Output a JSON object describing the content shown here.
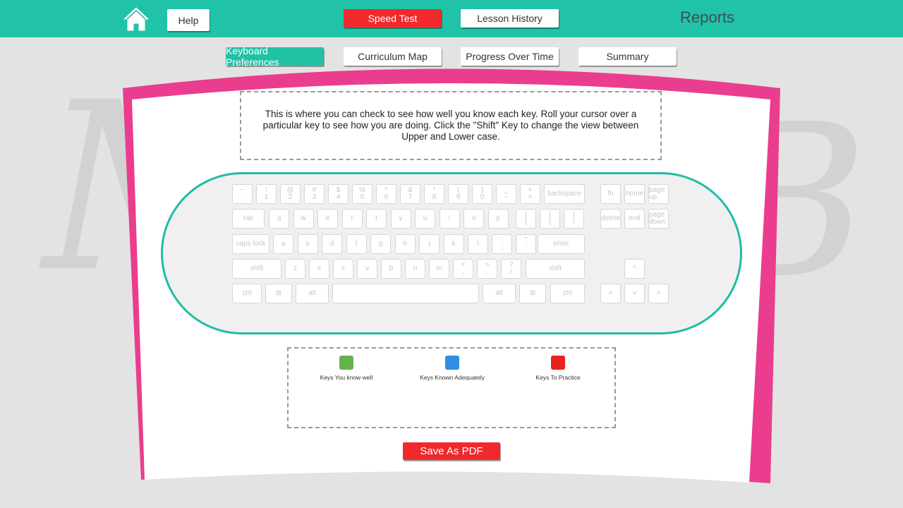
{
  "topbar": {
    "help_label": "Help",
    "speed_test_label": "Speed Test",
    "lesson_history_label": "Lesson History",
    "title": "Reports"
  },
  "subnav": {
    "tabs": [
      {
        "label": "Keyboard Preferences",
        "active": true
      },
      {
        "label": "Curriculum Map",
        "active": false
      },
      {
        "label": "Progress Over Time",
        "active": false
      },
      {
        "label": "Summary",
        "active": false
      }
    ]
  },
  "intro_text": "This is where you can check to see how well you know each key. Roll your cursor over a particular key to see how you are doing. Click the \"Shift\" Key to change the view between Upper and Lower case.",
  "keyboard": {
    "row1": [
      [
        "~",
        "`"
      ],
      [
        "!",
        "1"
      ],
      [
        "@",
        "2"
      ],
      [
        "#",
        "3"
      ],
      [
        "$",
        "4"
      ],
      [
        "%",
        "5"
      ],
      [
        "^",
        "6"
      ],
      [
        "&",
        "7"
      ],
      [
        "*",
        "8"
      ],
      [
        "(",
        "9"
      ],
      [
        ")",
        "0"
      ],
      [
        "_",
        "–"
      ],
      [
        "+",
        "="
      ]
    ],
    "backspace": "backspace",
    "tab": "tab",
    "row2": [
      "q",
      "w",
      "e",
      "r",
      "t",
      "y",
      "u",
      "i",
      "o",
      "p"
    ],
    "row2_sym": [
      [
        "{",
        "["
      ],
      [
        "}",
        "]"
      ],
      [
        "|",
        "\\"
      ]
    ],
    "caps": "caps lock",
    "row3": [
      "a",
      "s",
      "d",
      "f",
      "g",
      "h",
      "j",
      "k",
      "l"
    ],
    "row3_sym": [
      [
        ":",
        ";"
      ],
      [
        "\"",
        "'"
      ]
    ],
    "enter": "enter",
    "shift_left": "shift",
    "row4": [
      "z",
      "x",
      "c",
      "v",
      "b",
      "n",
      "m"
    ],
    "row4_sym": [
      [
        "<",
        ","
      ],
      [
        ">",
        "."
      ],
      [
        "?",
        "/"
      ]
    ],
    "shift_right": "shift",
    "ctrl": "ctrl",
    "alt": "alt",
    "nav": [
      "fn",
      "home",
      "page up",
      "delete",
      "end",
      "page down"
    ],
    "arrows": [
      "^",
      "<",
      "v",
      ">"
    ]
  },
  "legend": [
    {
      "label": "Keys You know well",
      "color": "#66b34e"
    },
    {
      "label": "Keys Known Adequately",
      "color": "#2f8fe0"
    },
    {
      "label": "Keys To Practice",
      "color": "#e8231f"
    }
  ],
  "save_pdf_label": "Save As PDF",
  "colors": {
    "teal": "#20c3a7",
    "pink": "#ea3d8e",
    "red": "#f0292d"
  }
}
